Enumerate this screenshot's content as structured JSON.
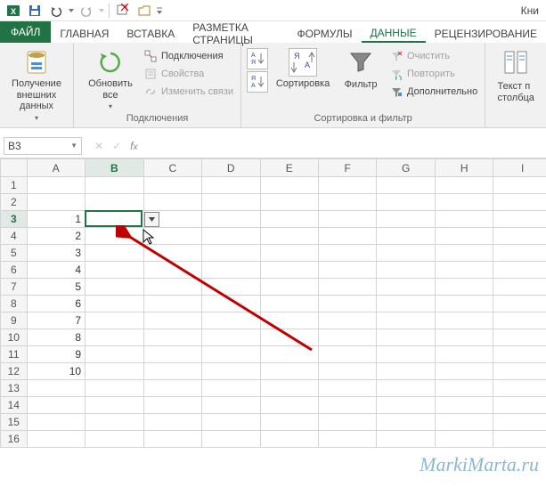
{
  "titlebar": {
    "title": "Кни"
  },
  "tabs": {
    "file": "ФАЙЛ",
    "home": "ГЛАВНАЯ",
    "insert": "ВСТАВКА",
    "page_layout": "РАЗМЕТКА СТРАНИЦЫ",
    "formulas": "ФОРМУЛЫ",
    "data": "ДАННЫЕ",
    "review": "РЕЦЕНЗИРОВАНИЕ"
  },
  "ribbon": {
    "get_external": {
      "label": "Получение\nвнешних данных",
      "group": ""
    },
    "connections": {
      "refresh": "Обновить\nвсе",
      "connections": "Подключения",
      "properties": "Свойства",
      "edit_links": "Изменить связи",
      "group": "Подключения"
    },
    "sort_filter": {
      "sort": "Сортировка",
      "filter": "Фильтр",
      "clear": "Очистить",
      "reapply": "Повторить",
      "advanced": "Дополнительно",
      "group": "Сортировка и фильтр"
    },
    "text_cols": {
      "label": "Текст п\nстолбца"
    }
  },
  "namebox": {
    "ref": "B3"
  },
  "columns": [
    "A",
    "B",
    "C",
    "D",
    "E",
    "F",
    "G",
    "H",
    "I"
  ],
  "rows": [
    "1",
    "2",
    "3",
    "4",
    "5",
    "6",
    "7",
    "8",
    "9",
    "10",
    "11",
    "12",
    "13",
    "14",
    "15",
    "16"
  ],
  "cells": {
    "A3": "1",
    "A4": "2",
    "A5": "3",
    "A6": "4",
    "A7": "5",
    "A8": "6",
    "A9": "7",
    "A10": "8",
    "A11": "9",
    "A12": "10"
  },
  "active": {
    "col": "B",
    "row": "3"
  },
  "watermark": "MarkiMarta.ru",
  "chart_data": {
    "type": "table",
    "columns": [
      "A"
    ],
    "rows": [
      1,
      2,
      3,
      4,
      5,
      6,
      7,
      8,
      9,
      10
    ]
  }
}
